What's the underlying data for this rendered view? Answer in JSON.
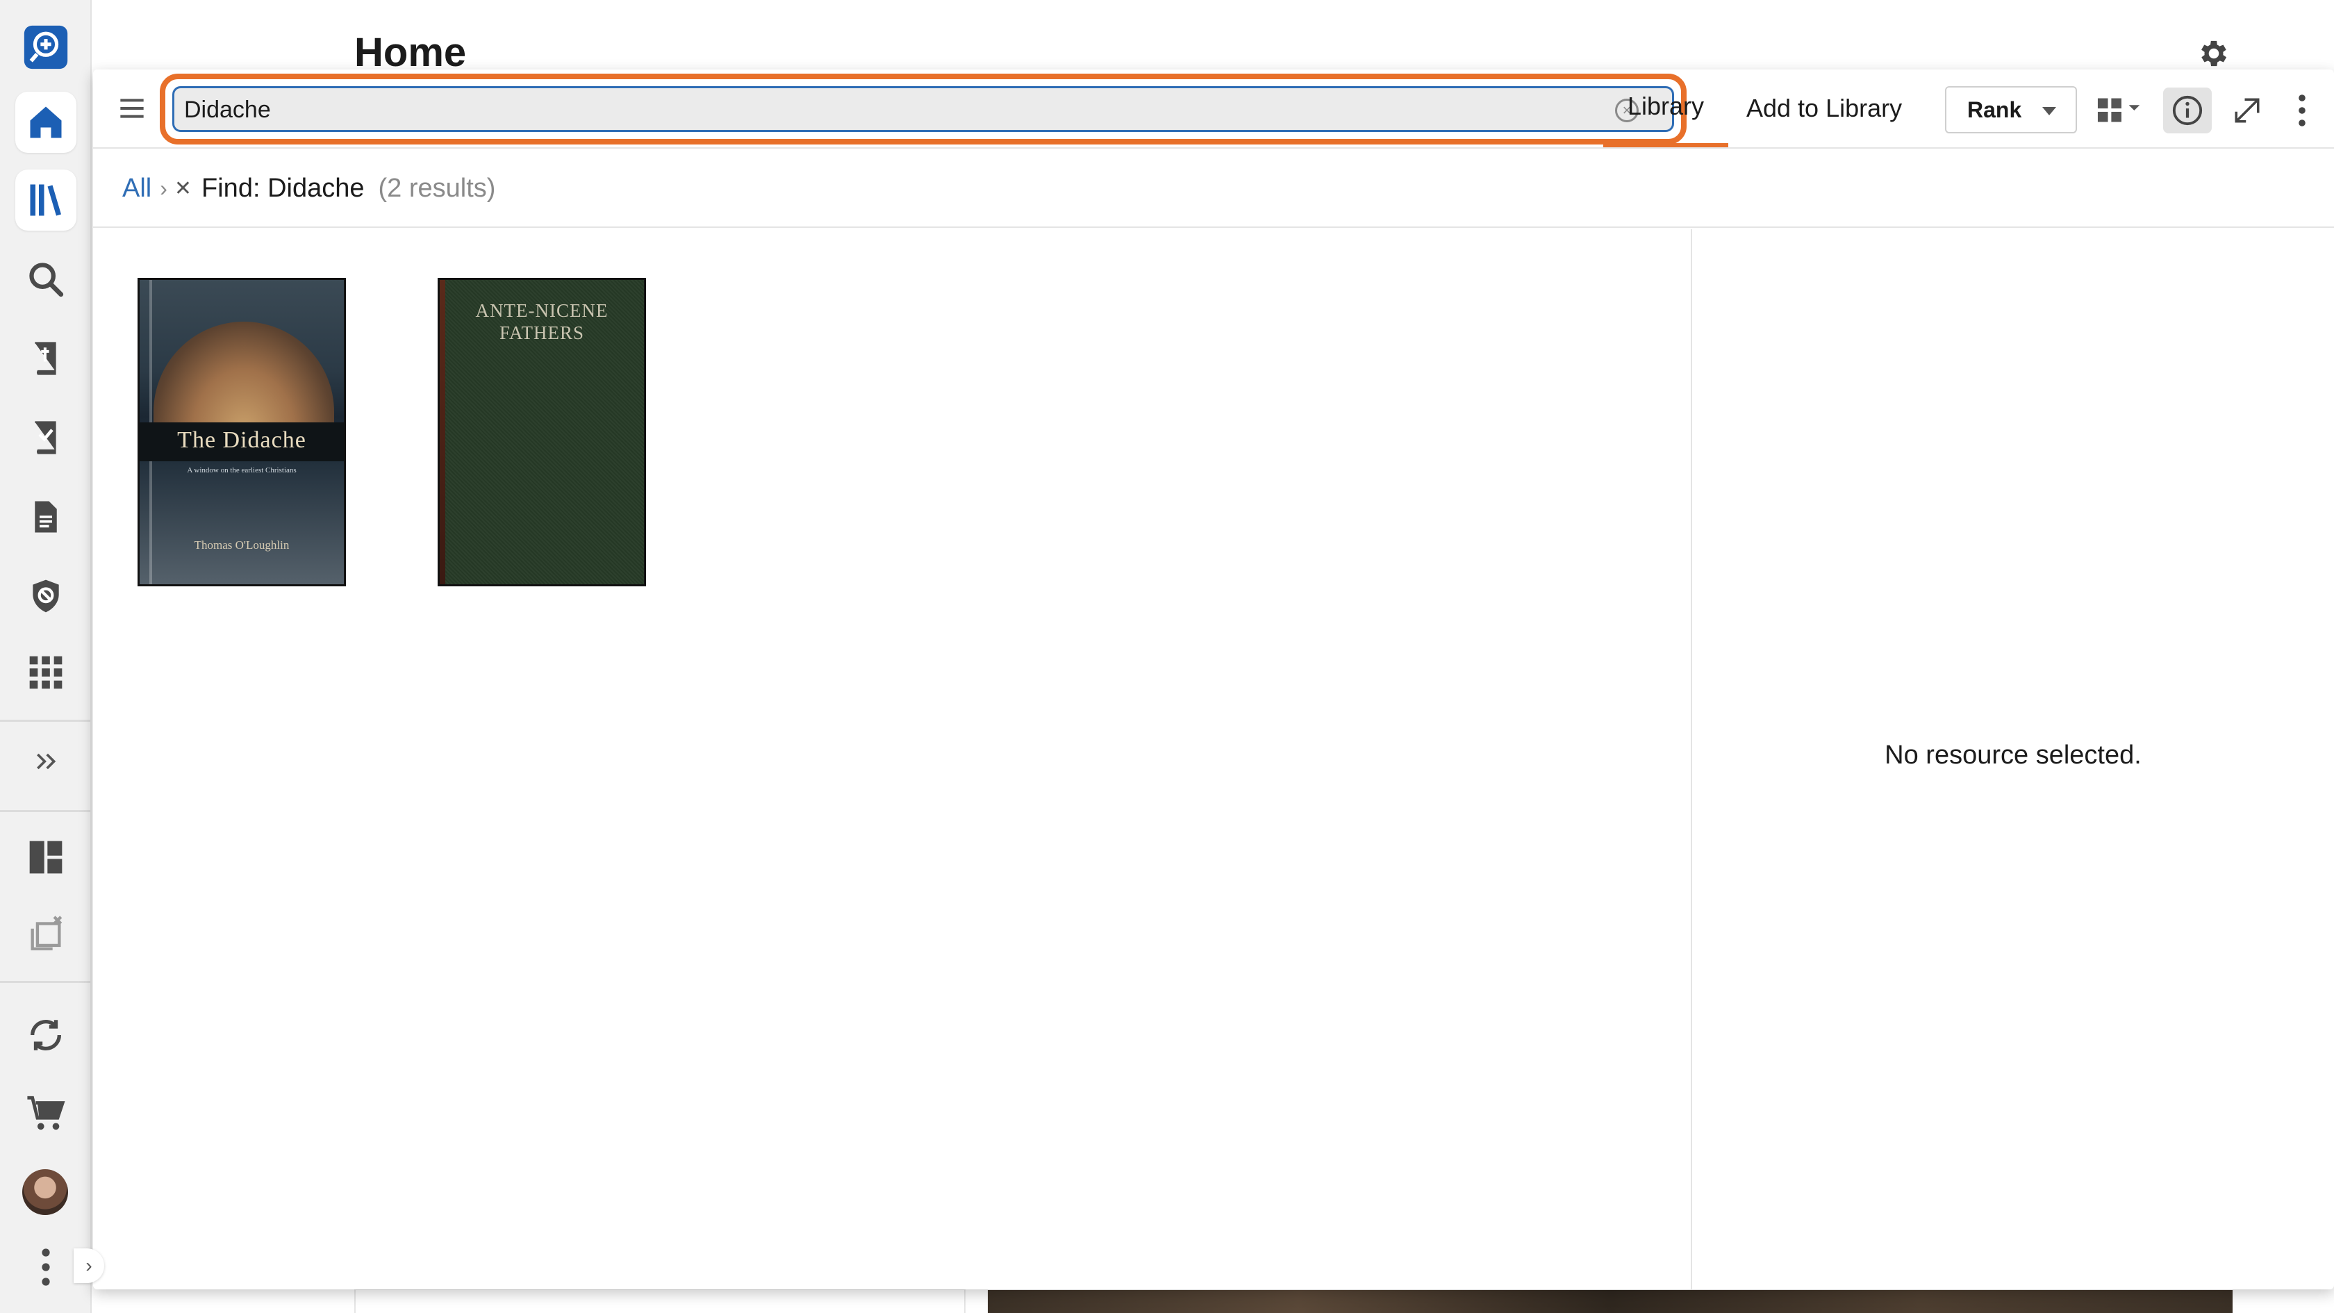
{
  "home": {
    "title": "Home"
  },
  "rail": {
    "items": [
      {
        "name": "logos-logo-icon",
        "active": false
      },
      {
        "name": "home-icon",
        "active": false
      },
      {
        "name": "library-icon",
        "active": true
      },
      {
        "name": "search-icon",
        "active": false
      },
      {
        "name": "bible-icon",
        "active": false
      },
      {
        "name": "reading-plan-icon",
        "active": false
      },
      {
        "name": "documents-icon",
        "active": false
      },
      {
        "name": "shield-icon",
        "active": false
      },
      {
        "name": "apps-grid-icon",
        "active": false
      },
      {
        "name": "expand-icon",
        "active": false
      },
      {
        "name": "dashboard-icon",
        "active": false
      },
      {
        "name": "close-panels-icon",
        "active": false
      },
      {
        "name": "sync-icon",
        "active": false
      },
      {
        "name": "cart-icon",
        "active": false
      },
      {
        "name": "avatar",
        "active": false
      },
      {
        "name": "more-vertical-icon",
        "active": false
      }
    ]
  },
  "panel": {
    "search": {
      "value": "Didache",
      "clear_icon": "clear-icon"
    },
    "tabs": [
      {
        "label": "Library",
        "active": true
      },
      {
        "label": "Add to Library",
        "active": false
      }
    ],
    "sort": {
      "selected": "Rank"
    },
    "breadcrumb": {
      "root": "All",
      "find_label": "Find: Didache",
      "count": "(2 results)"
    },
    "books": [
      {
        "title": "The Didache",
        "subtitle": "A window on the earliest Christians",
        "author": "Thomas O'Loughlin"
      },
      {
        "title_line1": "ANTE-NICENE",
        "title_line2": "FATHERS"
      }
    ],
    "detail": {
      "empty_message": "No resource selected."
    }
  },
  "colors": {
    "accent": "#e8702a",
    "link": "#2f6db5",
    "rail_active": "#1c5fb4"
  }
}
